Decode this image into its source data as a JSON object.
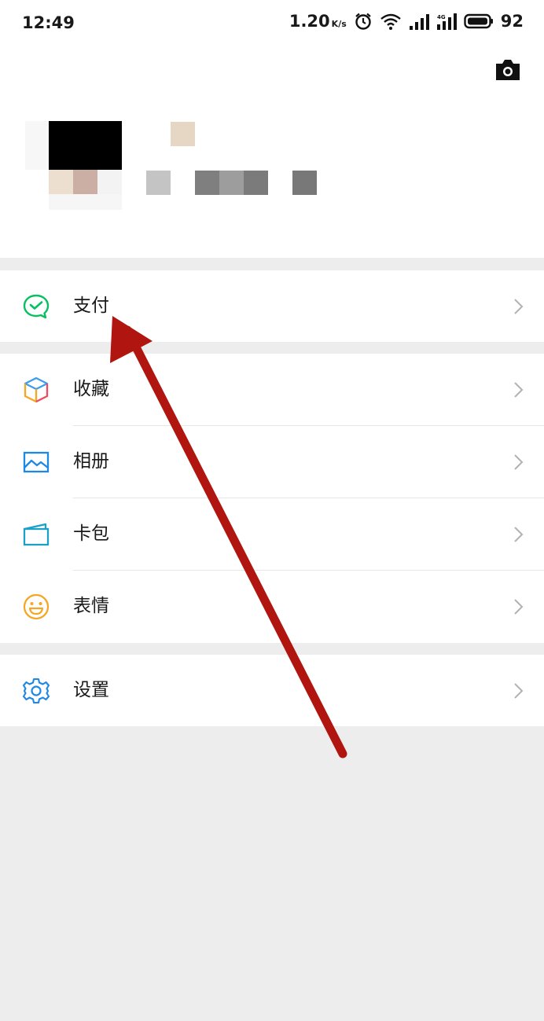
{
  "status_bar": {
    "time": "12:49",
    "net_speed": "1.20",
    "net_speed_unit": "K/s",
    "battery": "92"
  },
  "menu": {
    "pay": "支付",
    "favorites": "收藏",
    "album": "相册",
    "cards": "卡包",
    "stickers": "表情",
    "settings": "设置"
  },
  "colors": {
    "pay_green": "#07c160",
    "album_blue": "#1e88e5",
    "sticker_orange": "#f5a623",
    "arrow_red": "#b0160f"
  },
  "icons": [
    "camera-icon",
    "wechat-pay-icon",
    "favorites-cube-icon",
    "album-icon",
    "card-wallet-icon",
    "sticker-smile-icon",
    "settings-gear-icon",
    "chevron-right-icon"
  ]
}
